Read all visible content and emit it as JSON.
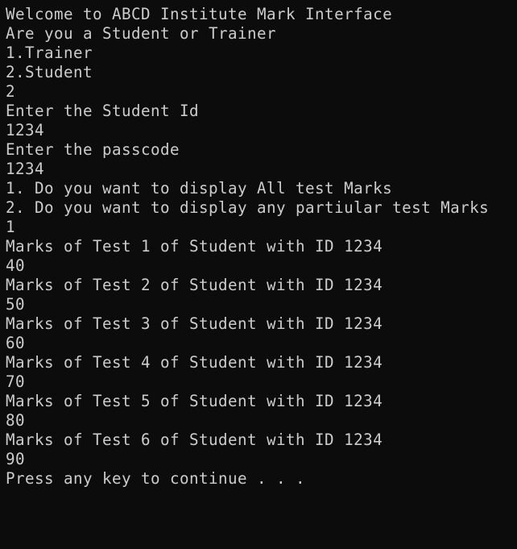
{
  "console": {
    "lines": [
      "Welcome to ABCD Institute Mark Interface",
      "Are you a Student or Trainer",
      "1.Trainer",
      "2.Student",
      "2",
      "Enter the Student Id",
      "1234",
      "Enter the passcode",
      "1234",
      "1. Do you want to display All test Marks",
      "2. Do you want to display any partiular test Marks",
      "1",
      "Marks of Test 1 of Student with ID 1234",
      "40",
      "Marks of Test 2 of Student with ID 1234",
      "50",
      "Marks of Test 3 of Student with ID 1234",
      "60",
      "Marks of Test 4 of Student with ID 1234",
      "70",
      "Marks of Test 5 of Student with ID 1234",
      "80",
      "Marks of Test 6 of Student with ID 1234",
      "90",
      "Press any key to continue . . ."
    ]
  },
  "colors": {
    "background": "#0c0c0c",
    "text": "#cccccc"
  }
}
